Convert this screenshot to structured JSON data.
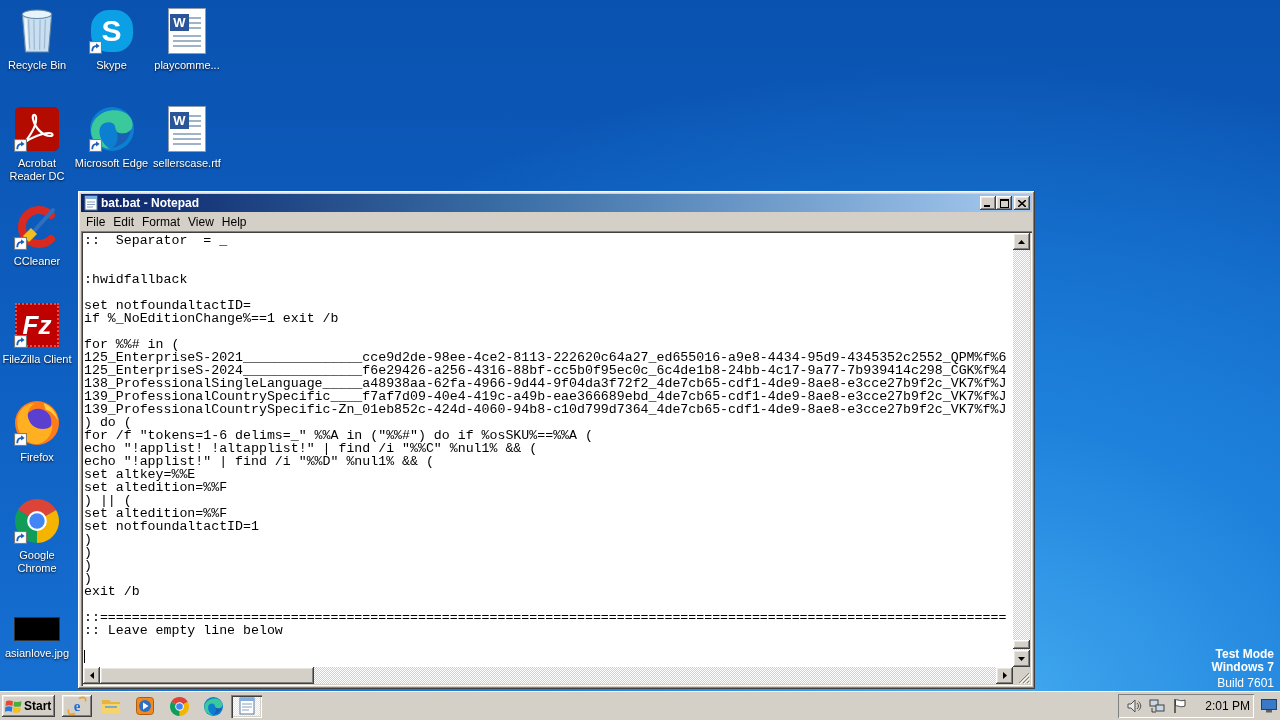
{
  "desktop": {
    "icon_columns": [
      [
        {
          "label": "Recycle Bin",
          "kind": "trash",
          "shortcut": false
        },
        {
          "label": "Acrobat Reader DC",
          "kind": "acrobat",
          "shortcut": true
        },
        {
          "label": "CCleaner",
          "kind": "ccleaner",
          "shortcut": true
        },
        {
          "label": "FileZilla Client",
          "kind": "filezilla",
          "logo_text": "Fz",
          "shortcut": true
        },
        {
          "label": "Firefox",
          "kind": "firefox",
          "shortcut": true
        },
        {
          "label": "Google Chrome",
          "kind": "chrome",
          "shortcut": true
        },
        {
          "label": "asianlove.jpg",
          "kind": "image",
          "shortcut": false
        }
      ],
      [
        {
          "label": "Skype",
          "kind": "skype",
          "logo_text": "S",
          "shortcut": true
        },
        {
          "label": "Microsoft Edge",
          "kind": "edge",
          "shortcut": true
        }
      ],
      [
        {
          "label": "playcomme...",
          "kind": "word",
          "logo_text": "W",
          "shortcut": false
        },
        {
          "label": "sellerscase.rtf",
          "kind": "word",
          "logo_text": "W",
          "shortcut": false
        }
      ]
    ],
    "test_mode": {
      "title": "Test Mode",
      "edition": "Windows 7",
      "build": "Build 7601"
    }
  },
  "window": {
    "title": "bat.bat - Notepad",
    "menu": [
      "File",
      "Edit",
      "Format",
      "View",
      "Help"
    ],
    "text": "::  Separator  = _\n\n\n:hwidfallback\n\nset notfoundaltactID=\nif %_NoEditionChange%==1 exit /b\n\nfor %%# in (\n125_EnterpriseS-2021_______________cce9d2de-98ee-4ce2-8113-222620c64a27_ed655016-a9e8-4434-95d9-4345352c2552_QPM%f%6\n125_EnterpriseS-2024_______________f6e29426-a256-4316-88bf-cc5b0f95ec0c_6c4de1b8-24bb-4c17-9a77-7b939414c298_CGK%f%4\n138_ProfessionalSingleLanguage_____a48938aa-62fa-4966-9d44-9f04da3f72f2_4de7cb65-cdf1-4de9-8ae8-e3cce27b9f2c_VK7%f%J\n139_ProfessionalCountrySpecific____f7af7d09-40e4-419c-a49b-eae366689ebd_4de7cb65-cdf1-4de9-8ae8-e3cce27b9f2c_VK7%f%J\n139_ProfessionalCountrySpecific-Zn_01eb852c-424d-4060-94b8-c10d799d7364_4de7cb65-cdf1-4de9-8ae8-e3cce27b9f2c_VK7%f%J\n) do (\nfor /f \"tokens=1-6 delims=_\" %%A in (\"%%#\") do if %osSKU%==%%A (\necho \"!applist! !altapplist!\" | find /i \"%%C\" %nul1% && (\necho \"!applist!\" | find /i \"%%D\" %nul1% && (\nset altkey=%%E\nset altedition=%%F\n) || (\nset altedition=%%F\nset notfoundaltactID=1\n)\n)\n)\n)\nexit /b\n\n::==================================================================================================================\n:: Leave empty line below"
  },
  "taskbar": {
    "start": "Start",
    "quick_launch": [
      {
        "kind": "ie",
        "logo_text": "e",
        "highlighted": true
      },
      {
        "kind": "folder",
        "highlighted": false
      },
      {
        "kind": "media",
        "highlighted": false
      },
      {
        "kind": "chrome",
        "highlighted": false
      },
      {
        "kind": "edge",
        "highlighted": false
      }
    ],
    "windows": [
      {
        "kind": "notepad",
        "selected": true
      }
    ],
    "clock": "2:01 PM"
  }
}
